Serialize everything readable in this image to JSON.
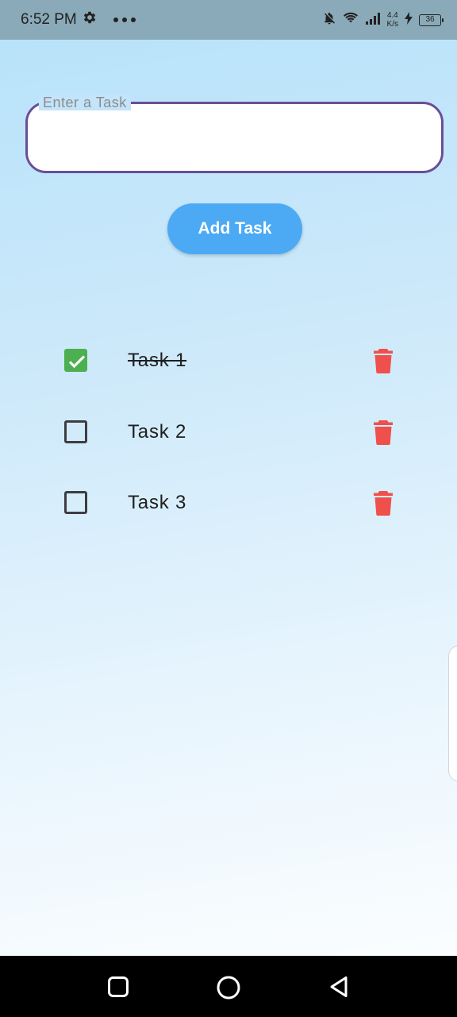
{
  "status_bar": {
    "time": "6:52 PM",
    "net_speed_value": "4.4",
    "net_speed_unit": "K/s",
    "battery": "36"
  },
  "task_input": {
    "label": "Enter a Task",
    "value": ""
  },
  "add_button": {
    "label": "Add Task"
  },
  "tasks": [
    {
      "label": "Task 1",
      "completed": true
    },
    {
      "label": "Task 2",
      "completed": false
    },
    {
      "label": "Task 3",
      "completed": false
    }
  ],
  "colors": {
    "accent_button": "#4caaf5",
    "input_border": "#6a4e98",
    "checkbox_checked": "#4caf50",
    "delete_icon": "#f0504c"
  },
  "icons": {
    "status_left": [
      "gear-icon",
      "more-dots-icon"
    ],
    "status_right": [
      "bell-off-icon",
      "wifi-icon",
      "signal-icon",
      "charging-icon",
      "battery-icon"
    ],
    "task_row": [
      "checkbox-icon",
      "trash-icon"
    ],
    "nav": [
      "recents-square-icon",
      "home-circle-icon",
      "back-triangle-icon"
    ]
  }
}
